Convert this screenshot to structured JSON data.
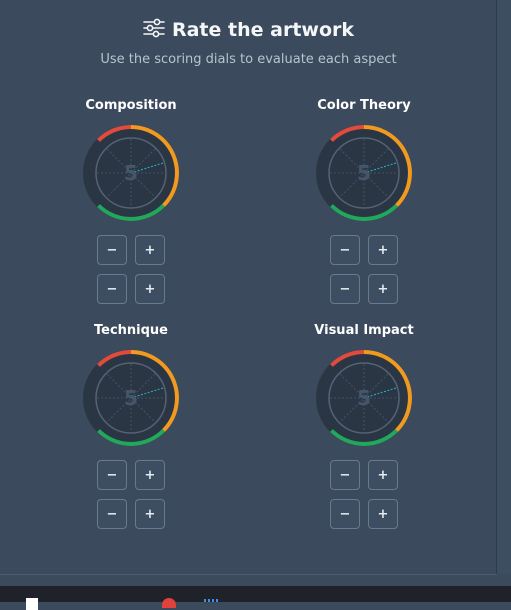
{
  "header": {
    "title": "Rate the artwork",
    "subtitle": "Use the scoring dials to evaluate each aspect",
    "icon": "sliders-icon"
  },
  "dials": [
    {
      "label": "Composition",
      "value": "5",
      "minus": "−",
      "plus": "+"
    },
    {
      "label": "Color Theory",
      "value": "5",
      "minus": "−",
      "plus": "+"
    },
    {
      "label": "Technique",
      "value": "5",
      "minus": "−",
      "plus": "+"
    },
    {
      "label": "Visual Impact",
      "value": "5",
      "minus": "−",
      "plus": "+"
    }
  ],
  "colors": {
    "background": "#3b4a5c",
    "dial_face": "#2b3645",
    "low": "#e24a3b",
    "mid": "#f29a1f",
    "high": "#21a85a",
    "needle": "#22b5c9"
  }
}
